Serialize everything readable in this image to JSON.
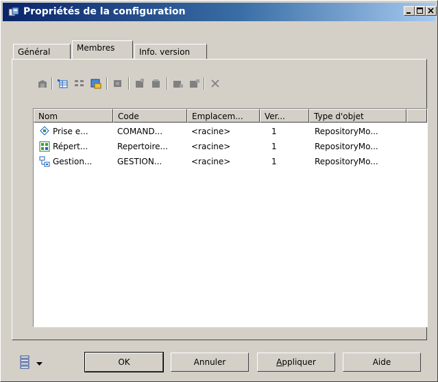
{
  "window": {
    "title": "Propriétés de la configuration",
    "controls": {
      "minimize": "minimize-icon",
      "maximize": "maximize-icon",
      "close": "close-icon"
    }
  },
  "tabs": [
    {
      "label": "Général",
      "active": false
    },
    {
      "label": "Membres",
      "active": true
    },
    {
      "label": "Info. version",
      "active": false
    }
  ],
  "toolbar": {
    "icons": [
      "properties-icon",
      "add-objects-icon",
      "add-list-icon",
      "add-shortcut-icon",
      "replace-icon",
      "consolidate-icon",
      "extract-icon",
      "compare-icon",
      "update-icon",
      "delete-icon"
    ]
  },
  "list": {
    "columns": [
      "Nom",
      "Code",
      "Emplacem...",
      "Ver...",
      "Type d'objet"
    ],
    "rows": [
      {
        "icon": "process-model-icon",
        "name": "Prise e...",
        "code": "COMAND...",
        "location": "<racine>",
        "version": "1",
        "type": "RepositoryMo..."
      },
      {
        "icon": "repository-model-icon",
        "name": "Répert...",
        "code": "Repertoire...",
        "location": "<racine>",
        "version": "1",
        "type": "RepositoryMo..."
      },
      {
        "icon": "hierarchy-model-icon",
        "name": "Gestion...",
        "code": "GESTION...",
        "location": "<racine>",
        "version": "1",
        "type": "RepositoryMo..."
      }
    ]
  },
  "buttons": {
    "ok": "OK",
    "cancel": "Annuler",
    "apply_underlined": "A",
    "apply_rest": "ppliquer",
    "help": "Aide"
  },
  "colors": {
    "title_start": "#0a246a",
    "title_end": "#a6caf0",
    "face": "#d4d0c8"
  }
}
